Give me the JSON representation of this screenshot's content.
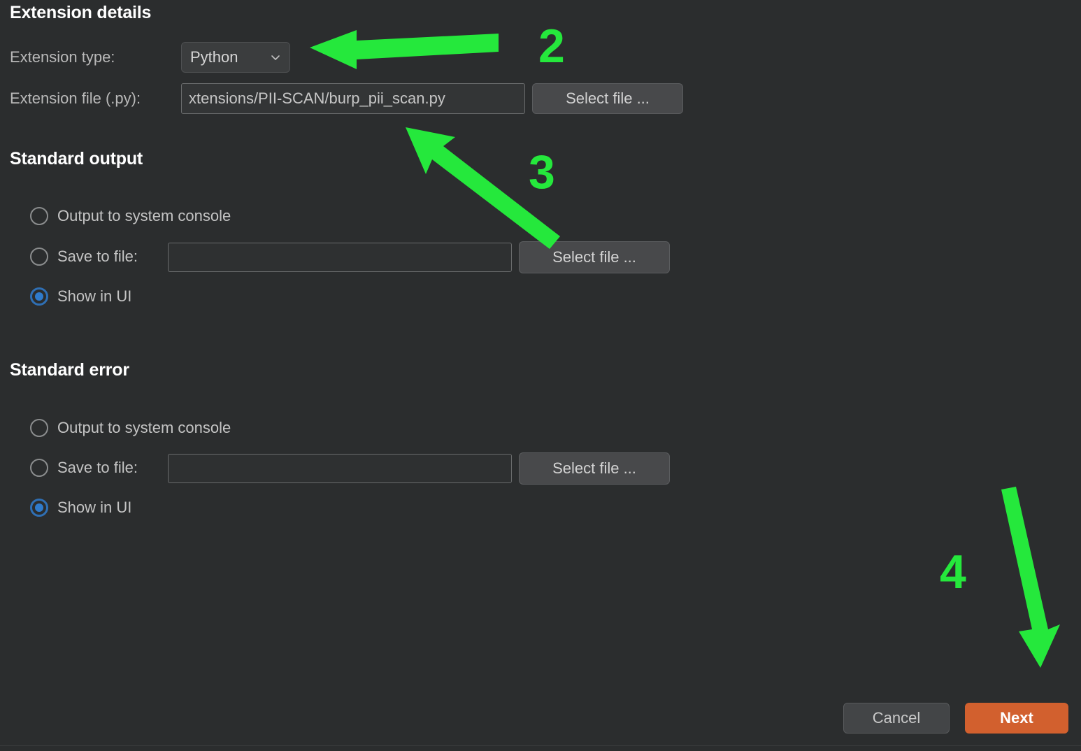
{
  "sections": {
    "extension_details": {
      "heading": "Extension details",
      "type_label": "Extension type:",
      "type_value": "Python",
      "file_label": "Extension file (.py):",
      "file_value": "xtensions/PII-SCAN/burp_pii_scan.py",
      "select_file_button": "Select file ..."
    },
    "standard_output": {
      "heading": "Standard output",
      "options": [
        {
          "label": "Output to system console",
          "checked": false
        },
        {
          "label": "Save to file:",
          "checked": false
        },
        {
          "label": "Show in UI",
          "checked": true
        }
      ],
      "file_value": "",
      "file_placeholder": "",
      "select_file_button": "Select file ..."
    },
    "standard_error": {
      "heading": "Standard error",
      "options": [
        {
          "label": "Output to system console",
          "checked": false
        },
        {
          "label": "Save to file:",
          "checked": false
        },
        {
          "label": "Show in UI",
          "checked": true
        }
      ],
      "file_value": "",
      "file_placeholder": "",
      "select_file_button": "Select file ..."
    }
  },
  "footer": {
    "cancel_label": "Cancel",
    "next_label": "Next"
  },
  "annotations": {
    "numbers": [
      "2",
      "3",
      "4"
    ],
    "color": "#25e83c",
    "arrows": [
      {
        "name": "arrow-to-extension-type",
        "number": "2"
      },
      {
        "name": "arrow-to-extension-file",
        "number": "3"
      },
      {
        "name": "arrow-to-next-button",
        "number": "4"
      }
    ]
  },
  "colors": {
    "background": "#2b2d2e",
    "accent_primary": "#d2602e",
    "radio_selected": "#2f7bcc",
    "annotation_green": "#25e83c",
    "heading_text": "#ffffff",
    "body_text": "#c4c4c4"
  },
  "icons": {
    "chevron_down": "chevron-down-icon"
  }
}
